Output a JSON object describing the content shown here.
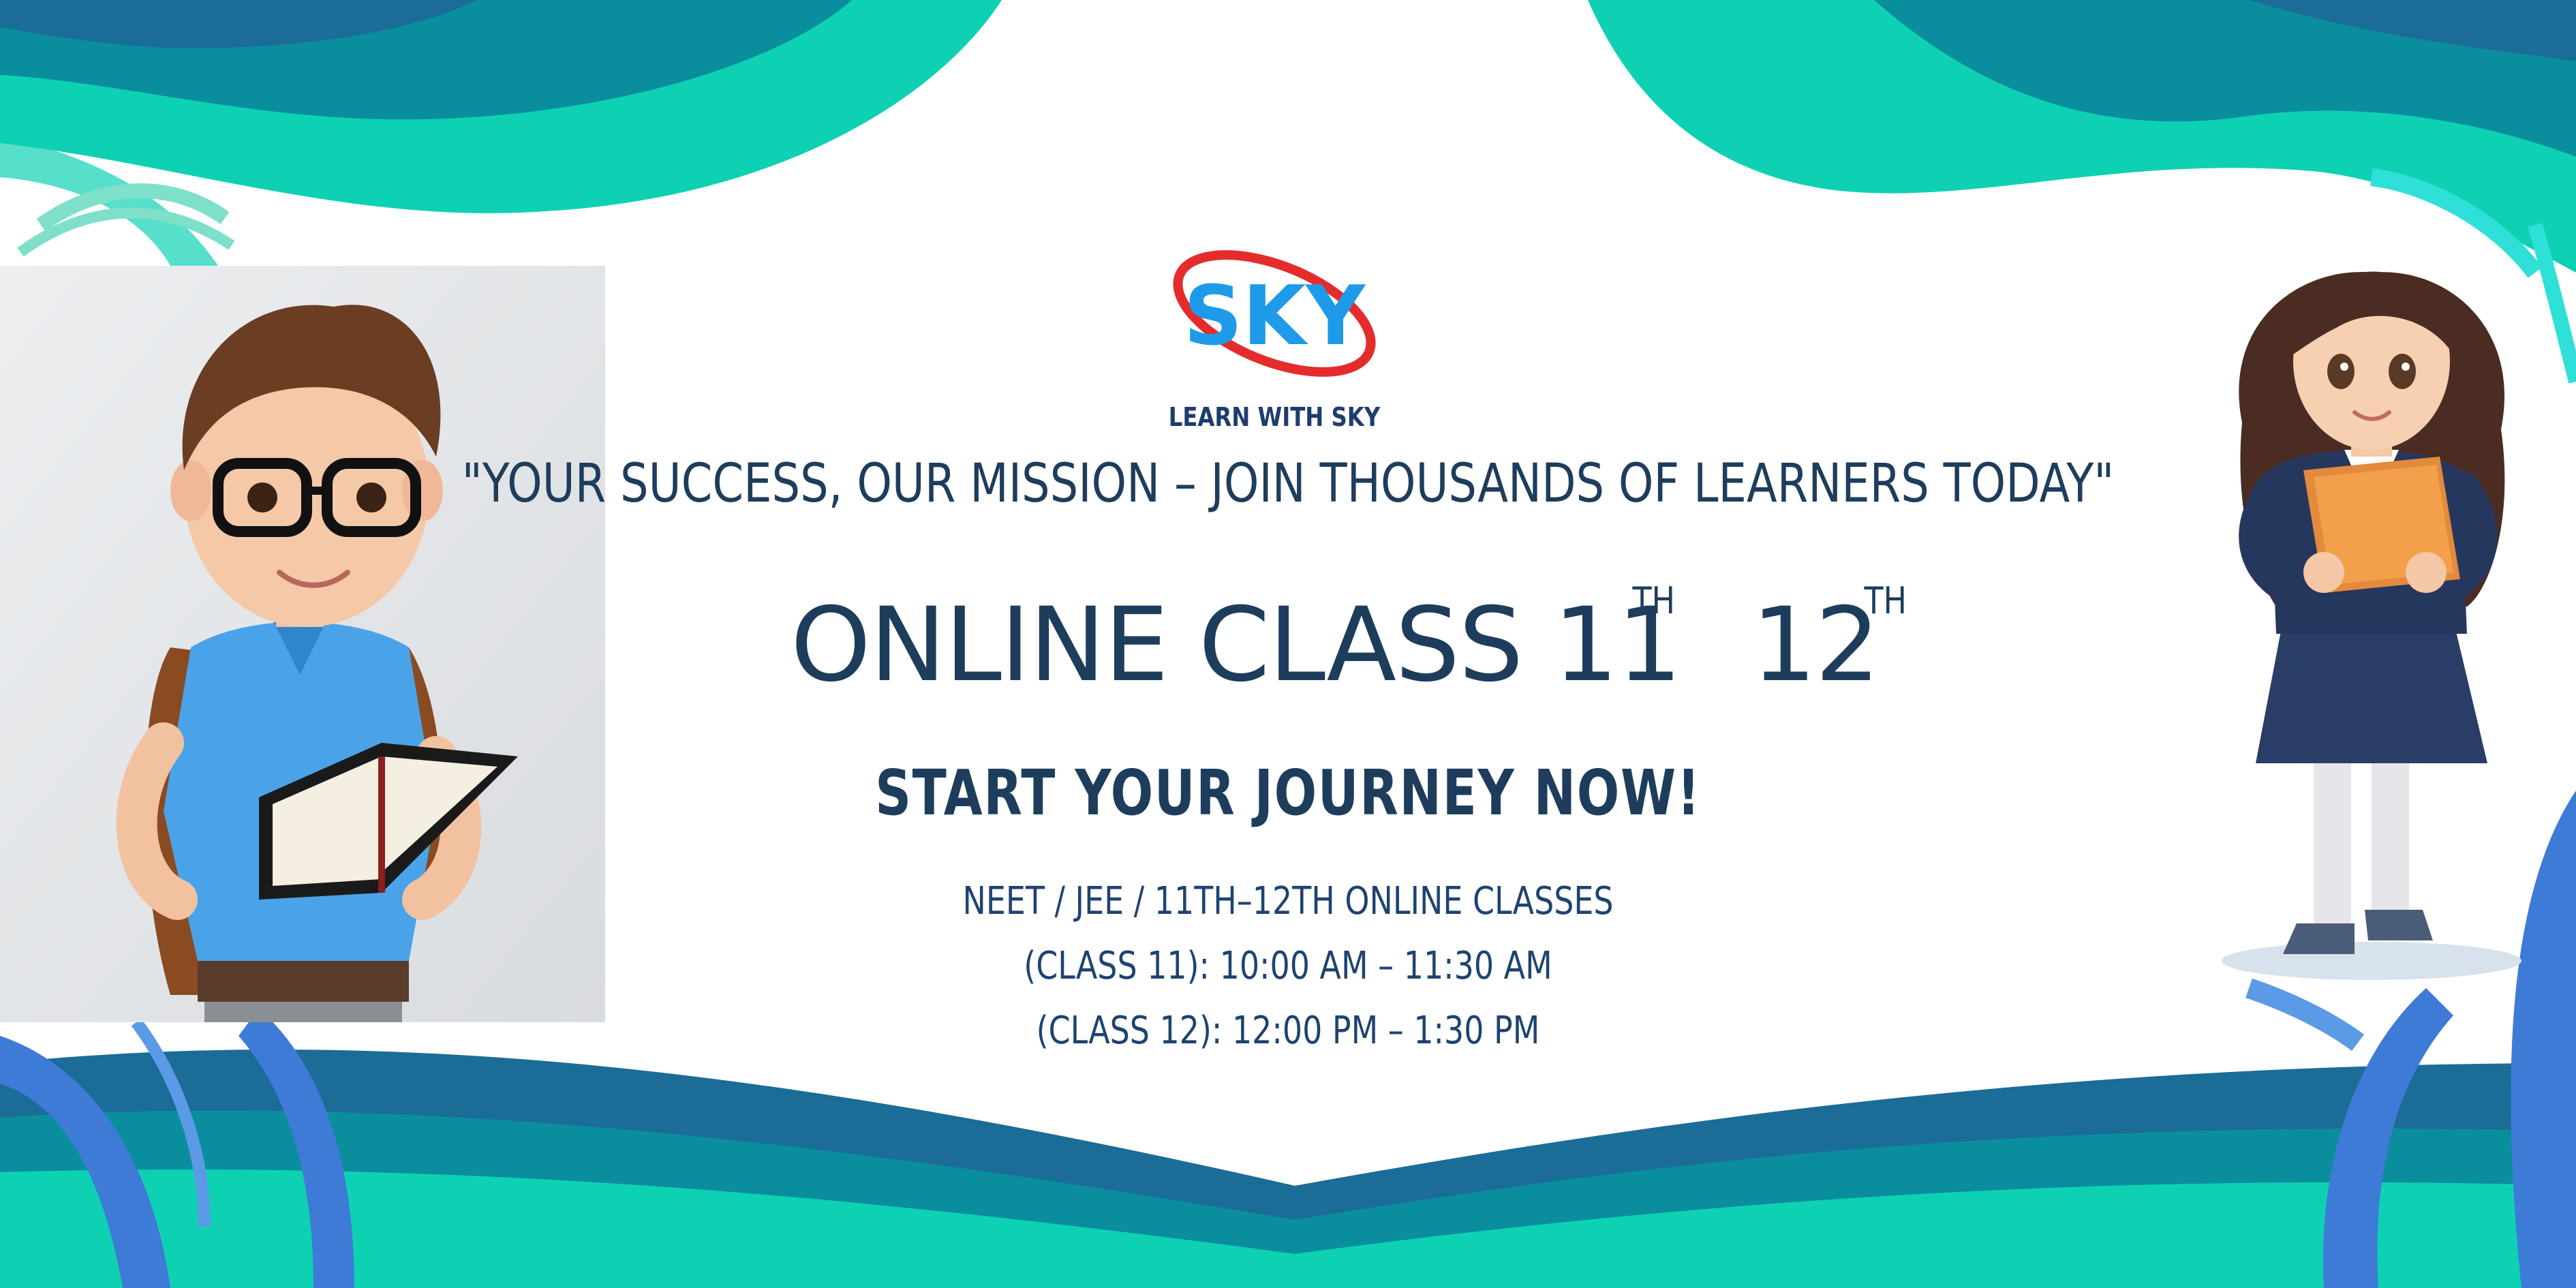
{
  "brand": {
    "logo_text": "SKY",
    "logo_subtitle": "LEARN WITH SKY"
  },
  "tagline": "\"YOUR SUCCESS, OUR MISSION – JOIN THOUSANDS OF LEARNERS TODAY\"",
  "headline": {
    "prefix": "ONLINE CLASS 11",
    "sup1": "TH",
    "grade2": "12",
    "sup2": "TH"
  },
  "cta": "START YOUR JOURNEY NOW!",
  "info_lines": [
    "NEET / JEE / 11TH–12TH ONLINE CLASSES",
    "(CLASS 11): 10:00 AM – 11:30 AM",
    "(CLASS 12): 12:00 PM – 1:30 PM"
  ],
  "colors": {
    "teal": "#0ed1b4",
    "deep_teal": "#0a8e9e",
    "blue": "#3d7bd6",
    "navy_text": "#1e3d5c",
    "logo_blue": "#1e9be8",
    "logo_red": "#e52c2c"
  },
  "illustrations": {
    "left": "boy-student-with-book",
    "right": "girl-student-with-folder"
  }
}
